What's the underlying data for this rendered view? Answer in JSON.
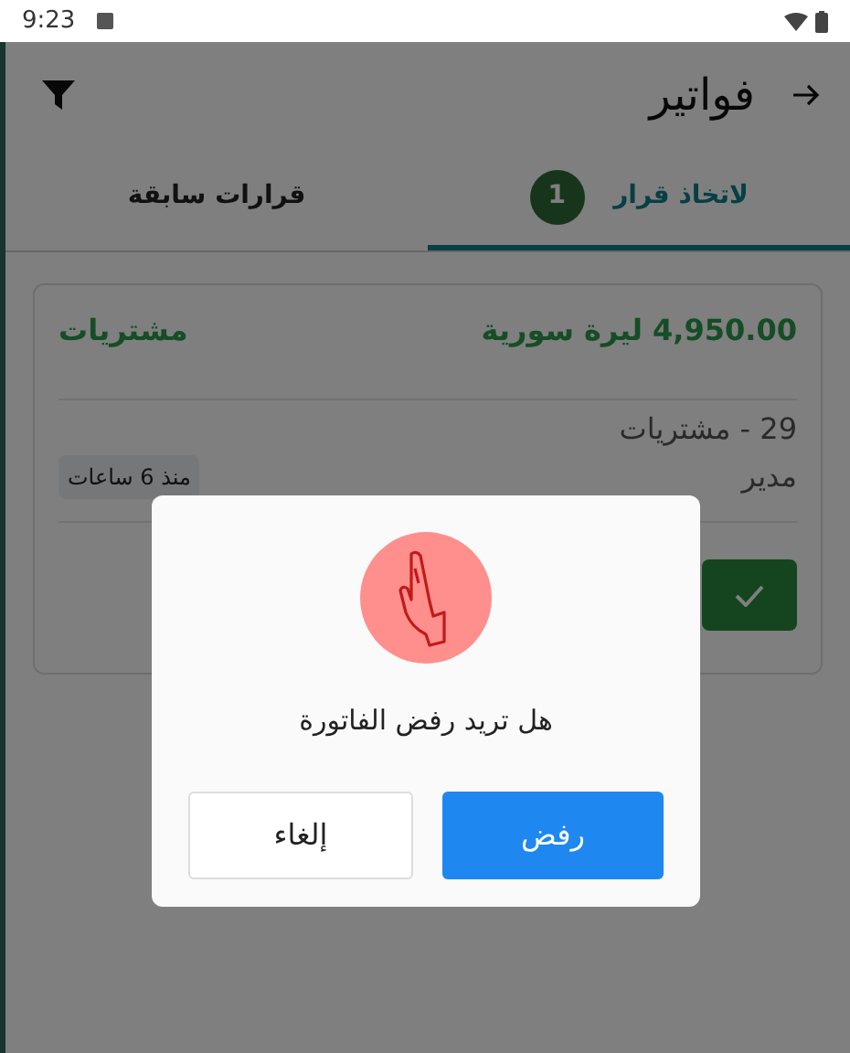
{
  "status_bar": {
    "time": "9:23"
  },
  "app_bar": {
    "title": "فواتير"
  },
  "tabs": [
    {
      "label": "لاتخاذ قرار",
      "badge": "1",
      "selected": true
    },
    {
      "label": "قرارات سابقة",
      "selected": false
    }
  ],
  "invoice": {
    "amount": "4,950.00 ليرة سورية",
    "category": "مشتريات",
    "reference": "29 - مشتريات",
    "role": "مدير",
    "time_ago": "منذ 6 ساعات"
  },
  "dialog": {
    "message": "هل تريد رفض الفاتورة",
    "confirm": "رفض",
    "cancel": "إلغاء"
  }
}
